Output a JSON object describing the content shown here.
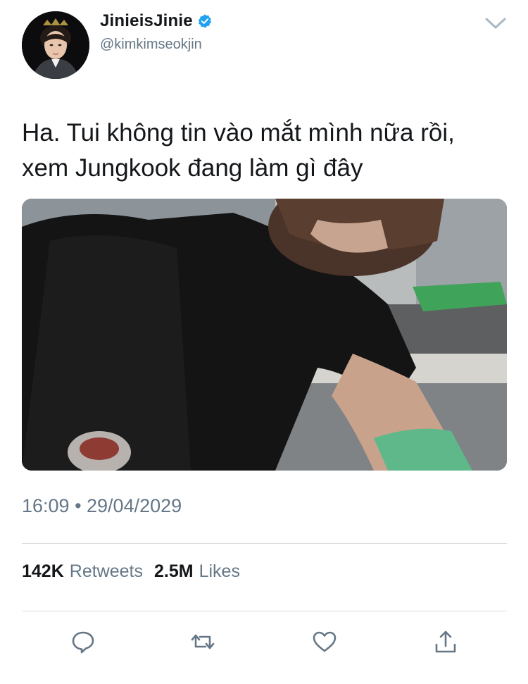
{
  "author": {
    "display_name": "JinieisJinie",
    "handle": "@kimkimseokjin",
    "verified": true,
    "avatar_icon": "profile-photo"
  },
  "tweet": {
    "text": "Ha. Tui không tin vào mắt mình nữa rồi, xem Jungkook đang làm gì đây",
    "timestamp": "16:09 • 29/04/2029"
  },
  "stats": {
    "retweets_count": "142K",
    "retweets_label": "Retweets",
    "likes_count": "2.5M",
    "likes_label": "Likes"
  },
  "actions": [
    "reply-icon",
    "retweet-icon",
    "like-icon",
    "share-icon"
  ],
  "colors": {
    "text": "#14171a",
    "secondary": "#657786",
    "verified": "#1da1f2",
    "divider": "#d9dde1"
  }
}
